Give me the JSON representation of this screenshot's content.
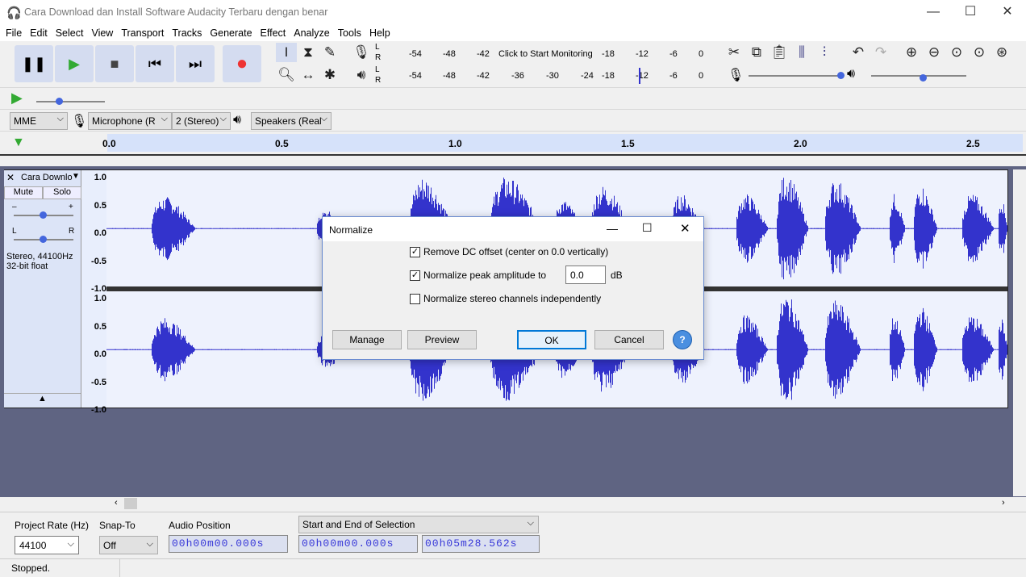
{
  "window": {
    "title": "Cara Download dan Install Software Audacity Terbaru dengan benar",
    "minimize": "—",
    "maximize": "☐",
    "close": "✕"
  },
  "menu": [
    "File",
    "Edit",
    "Select",
    "View",
    "Transport",
    "Tracks",
    "Generate",
    "Effect",
    "Analyze",
    "Tools",
    "Help"
  ],
  "transport": {
    "pause": "❚❚",
    "play": "▶",
    "stop": "■",
    "skip_start": "⏮",
    "skip_end": "⏭",
    "record": "●"
  },
  "meters": {
    "record_ticks": [
      "-54",
      "-48",
      "-42",
      "Click to Start Monitoring",
      "-18",
      "-12",
      "-6",
      "0"
    ],
    "play_ticks": [
      "-54",
      "-48",
      "-42",
      "-36",
      "-30",
      "-24",
      "-18",
      "-12",
      "-6",
      "0"
    ],
    "L": "L",
    "R": "R"
  },
  "device": {
    "host": "MME",
    "mic": "Microphone (R",
    "channels": "2 (Stereo)",
    "speakers": "Speakers (Real"
  },
  "ruler": {
    "labels": [
      "0.0",
      "0.5",
      "1.0",
      "1.5",
      "2.0",
      "2.5"
    ]
  },
  "track": {
    "name": "Cara Downlo",
    "mute": "Mute",
    "solo": "Solo",
    "format": "Stereo, 44100Hz",
    "bits": "32-bit float",
    "gain_minus": "–",
    "gain_plus": "+",
    "pan_l": "L",
    "pan_r": "R",
    "scale": [
      "1.0",
      "0.5",
      "0.0",
      "-0.5",
      "-1.0"
    ],
    "wave_color": "#3333cc"
  },
  "dialog": {
    "title": "Normalize",
    "remove_dc": "Remove DC offset (center on 0.0 vertically)",
    "remove_dc_checked": true,
    "normalize_peak": "Normalize peak amplitude to",
    "normalize_peak_checked": true,
    "peak_value": "0.0",
    "unit": "dB",
    "stereo_indep": "Normalize stereo channels independently",
    "stereo_indep_checked": false,
    "manage": "Manage",
    "preview": "Preview",
    "ok": "OK",
    "cancel": "Cancel",
    "help": "?"
  },
  "selection": {
    "rate_label": "Project Rate (Hz)",
    "rate": "44100",
    "snap_label": "Snap-To",
    "snap": "Off",
    "audio_pos_label": "Audio Position",
    "audio_pos": "00h00m00.000s",
    "sel_mode": "Start and End of Selection",
    "sel_start": "00h00m00.000s",
    "sel_end": "00h05m28.562s"
  },
  "status": "Stopped."
}
